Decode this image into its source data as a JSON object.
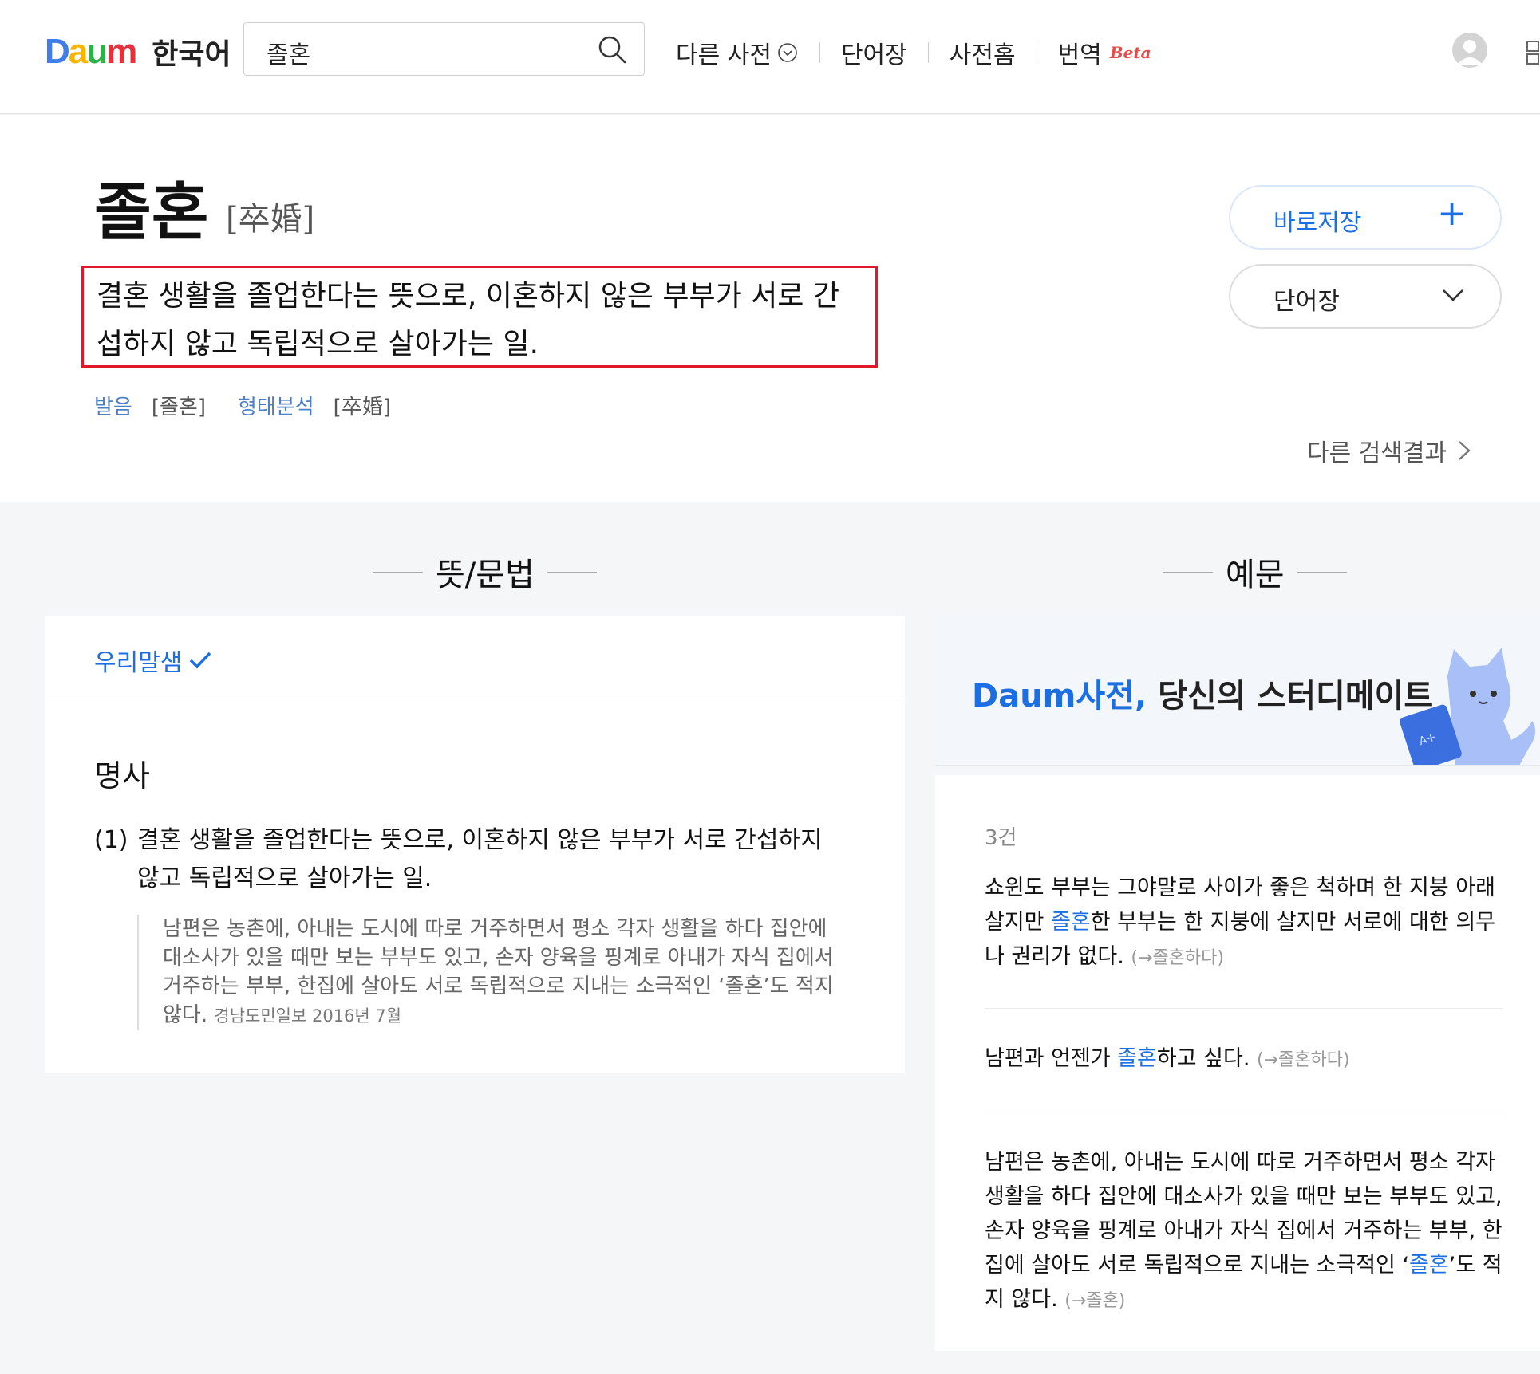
{
  "header": {
    "logo_text": "Daum",
    "logo_colors": [
      "#3f7de8",
      "#f7b500",
      "#2bb34a",
      "#e6303b",
      "#3f7de8"
    ],
    "dict_title": "한국어",
    "search_value": "졸혼",
    "nav": [
      {
        "label": "다른 사전"
      },
      {
        "label": "단어장"
      },
      {
        "label": "사전홈"
      },
      {
        "label": "번역",
        "badge": "Beta"
      }
    ]
  },
  "entry": {
    "word": "졸혼",
    "hanja": "[卒婚]",
    "definition": "결혼 생활을 졸업한다는 뜻으로, 이혼하지 않은 부부가 서로 간섭하지 않고 독립적으로 살아가는 일.",
    "pron_label": "발음",
    "pron_value": "[졸혼]",
    "morph_label": "형태분석",
    "morph_value": "[卒婚]",
    "save_label": "바로저장",
    "wordbook_label": "단어장",
    "other_results": "다른 검색결과"
  },
  "meaning": {
    "section_title": "뜻/문법",
    "source": "우리말샘",
    "pos": "명사",
    "sense_num": "(1)",
    "sense_text": "결혼 생활을 졸업한다는 뜻으로, 이혼하지 않은 부부가 서로 간섭하지 않고 독립적으로 살아가는 일.",
    "quote_text": "남편은 농촌에, 아내는 도시에 따로 거주하면서 평소 각자 생활을 하다 집안에 대소사가 있을 때만 보는 부부도 있고, 손자 양육을 핑계로 아내가 자식 집에서 거주하는 부부, 한집에 살아도 서로 독립적으로 지내는 소극적인 ‘졸혼’도 적지 않다.",
    "quote_source": "경남도민일보 2016년 7월"
  },
  "examples": {
    "section_title": "예문",
    "banner_brand": "Daum사전,",
    "banner_text": "당신의 스터디메이트",
    "count": "3건",
    "items": [
      {
        "pre": "쇼윈도 부부는 그야말로 사이가 좋은 척하며 한 지붕 아래 살지만 ",
        "hl": "졸혼",
        "post": "한 부부는 한 지붕에 살지만 서로에 대한 의무나 권리가 없다.",
        "ref": "(→졸혼하다)"
      },
      {
        "pre": "남편과 언젠가 ",
        "hl": "졸혼",
        "post": "하고 싶다.",
        "ref": "(→졸혼하다)"
      },
      {
        "pre": "남편은 농촌에, 아내는 도시에 따로 거주하면서 평소 각자 생활을 하다 집안에 대소사가 있을 때만 보는 부부도 있고, 손자 양육을 핑계로 아내가 자식 집에서 거주하는 부부, 한집에 살아도 서로 독립적으로 지내는 소극적인 ‘",
        "hl": "졸혼",
        "post": "’도 적지 않다.",
        "ref": "(→졸혼)"
      }
    ]
  },
  "colors": {
    "accent": "#1b6fe3",
    "highlight_box": "#e0182a",
    "beta": "#e84a4a"
  },
  "icons": [
    "search-icon",
    "chevron-down-circle-icon",
    "avatar-icon",
    "menu-icon",
    "plus-icon",
    "chevron-down-icon",
    "chevron-right-icon",
    "check-icon",
    "cat-illustration"
  ]
}
